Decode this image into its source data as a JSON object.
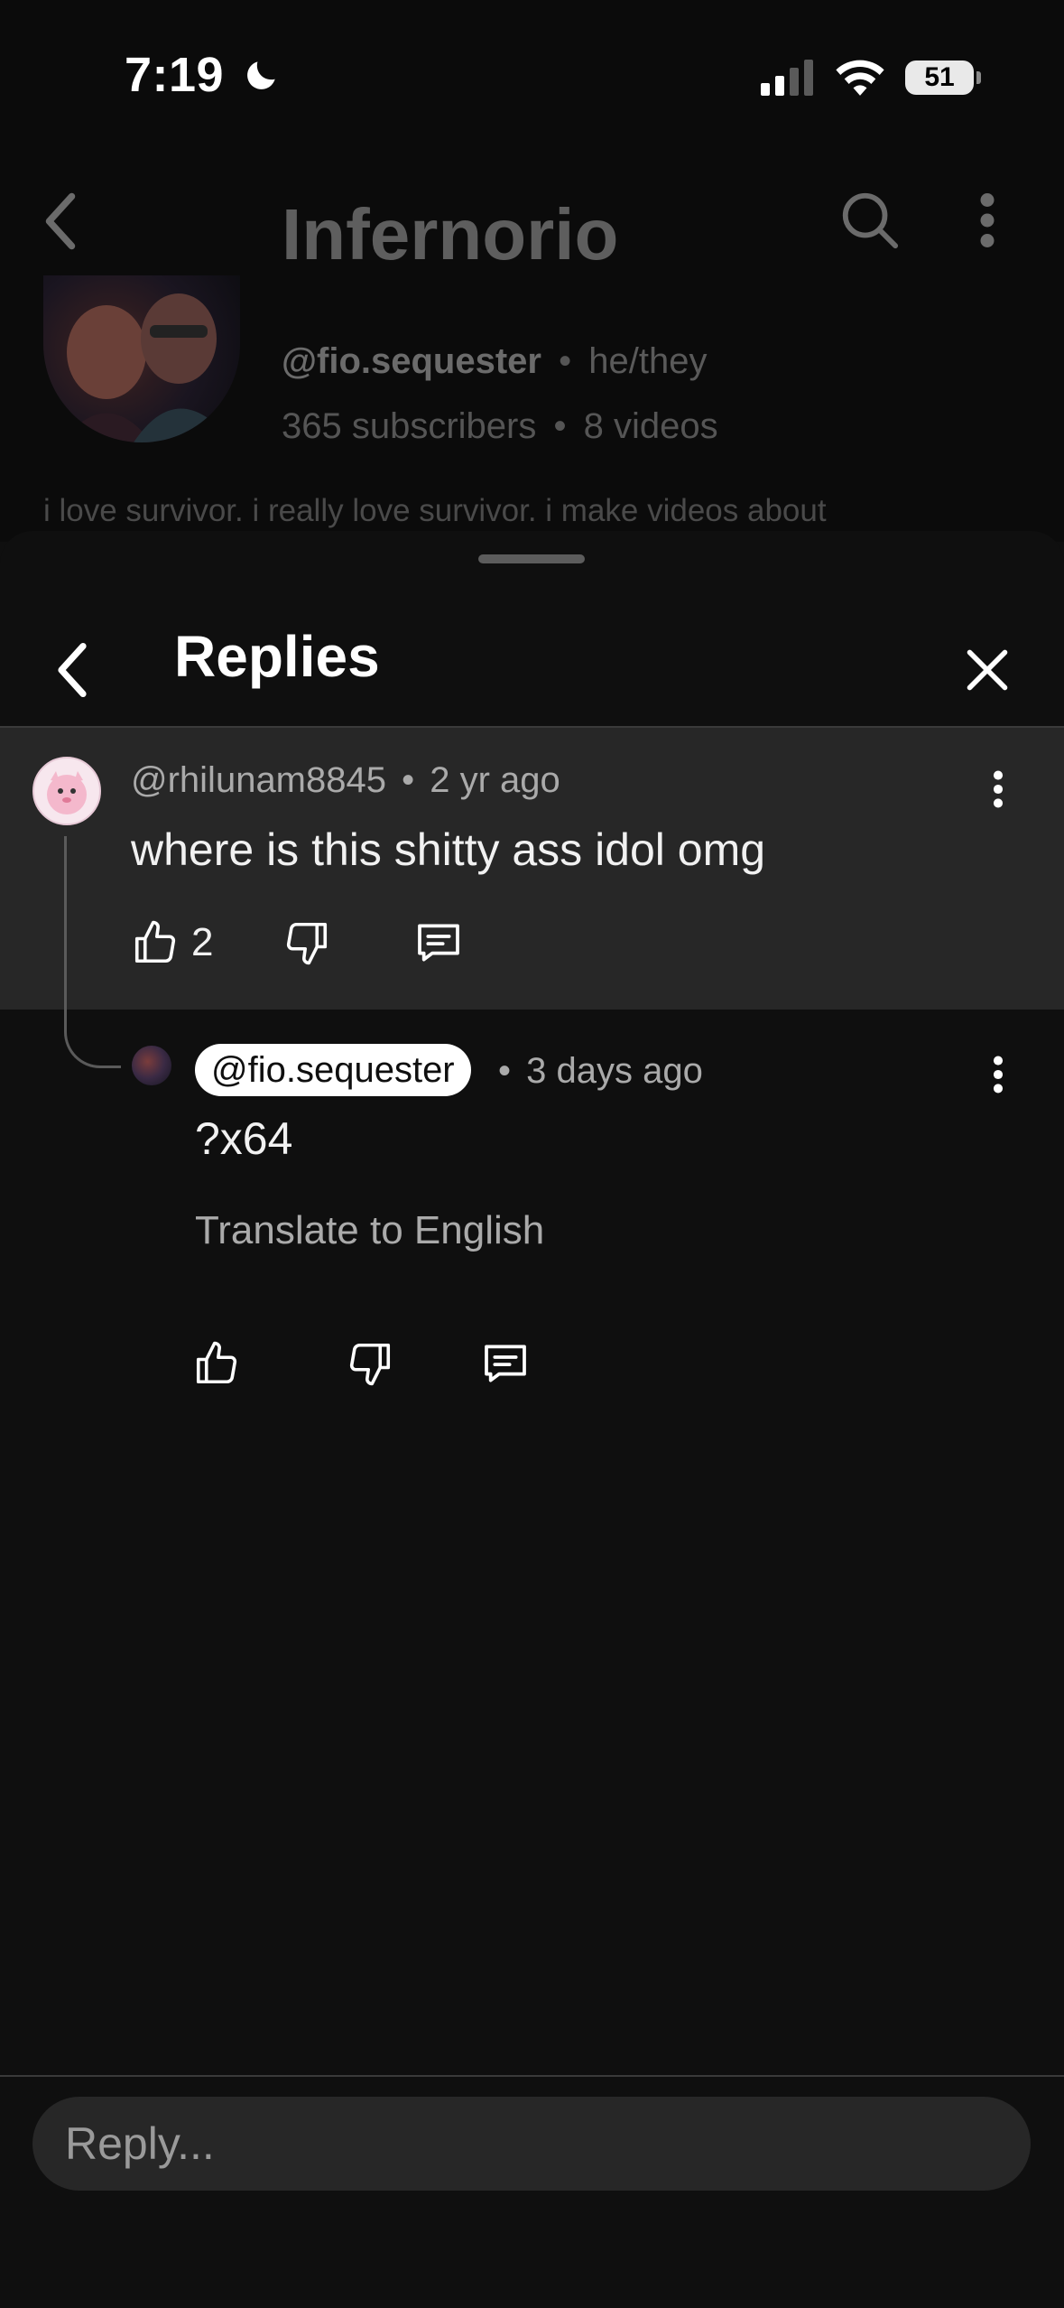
{
  "status_bar": {
    "time": "7:19",
    "battery": "51"
  },
  "background_page": {
    "channel_title": "Infernorio",
    "handle": "@fio.sequester",
    "pronouns": "he/they",
    "subscribers": "365 subscribers",
    "videos": "8 videos",
    "description": "i love survivor. i really love survivor. i make videos about"
  },
  "sheet": {
    "title": "Replies"
  },
  "parent_comment": {
    "author": "@rhilunam8845",
    "time": "2 yr ago",
    "text": "where is this shitty ass idol omg",
    "likes": "2"
  },
  "reply": {
    "author": "@fio.sequester",
    "time": "3 days ago",
    "text": "?x64",
    "translate_label": "Translate to English"
  },
  "reply_box": {
    "placeholder": "Reply..."
  },
  "separator": "•",
  "colors": {
    "background": "#0f0f0f",
    "highlight": "#272727",
    "text": "#f1f1f1",
    "muted": "#aaaaaa"
  }
}
